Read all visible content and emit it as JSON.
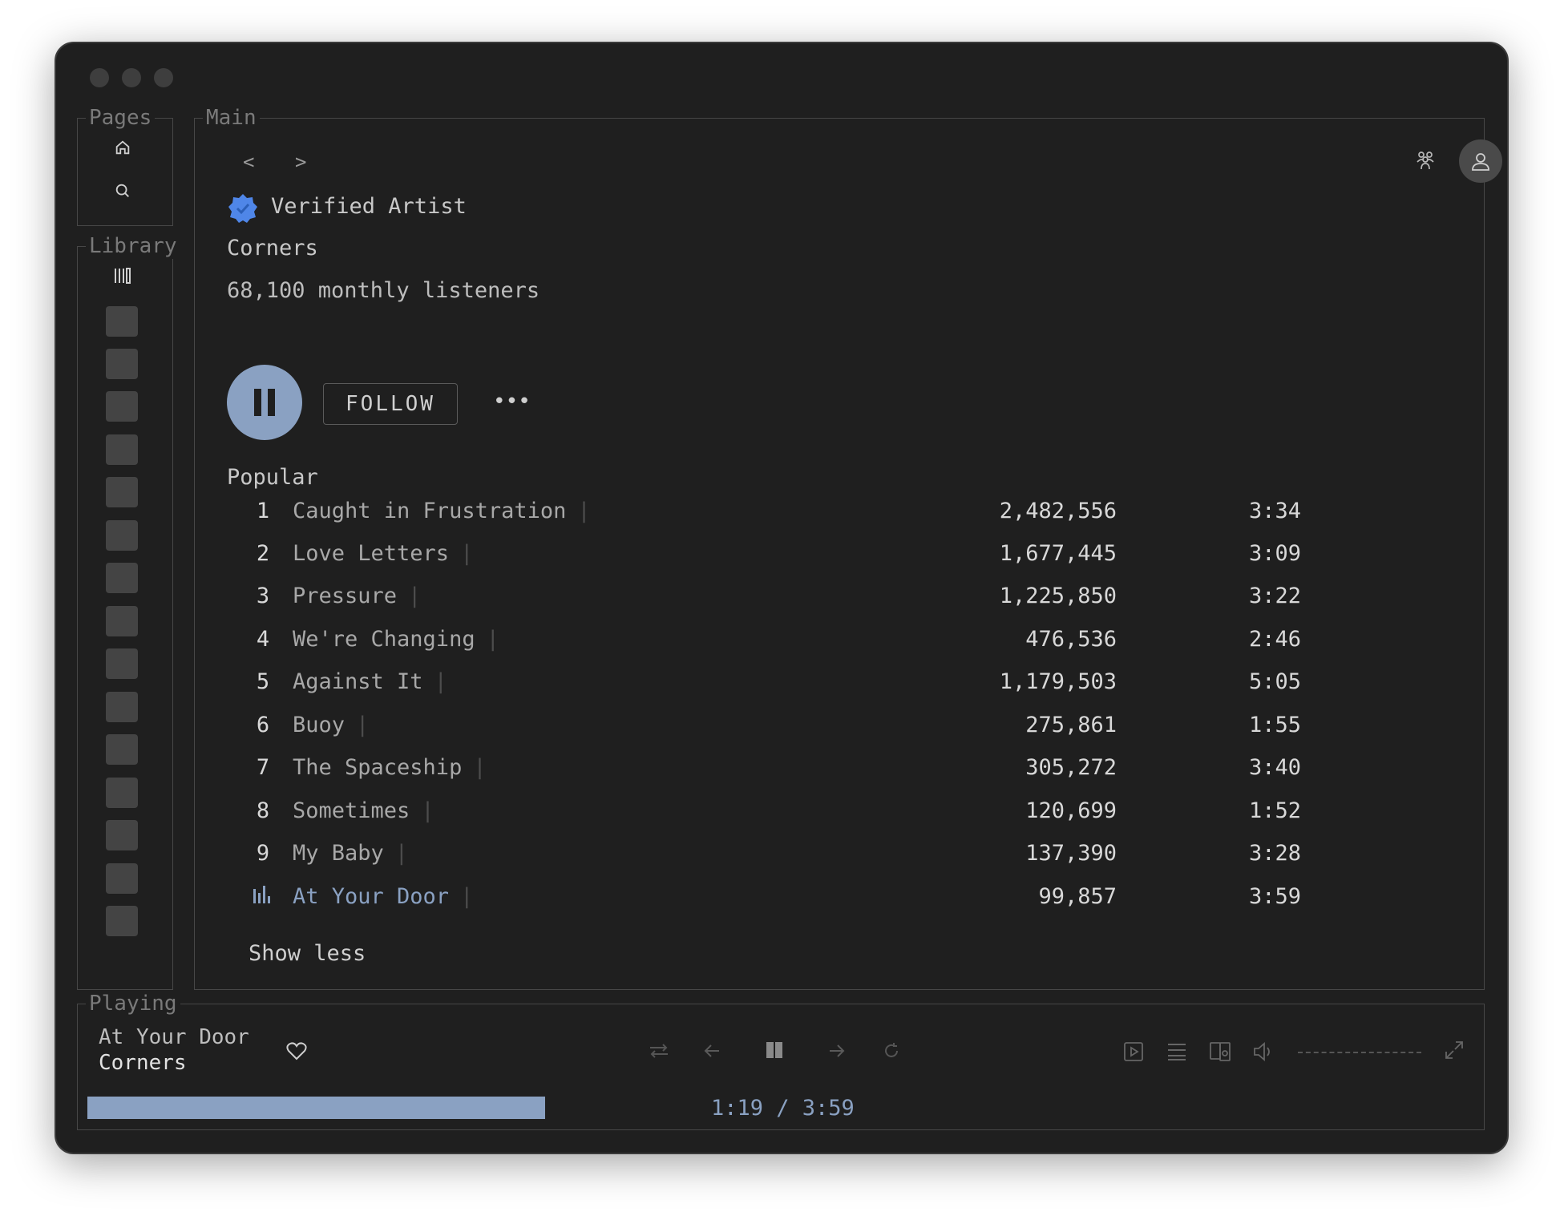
{
  "sections": {
    "pages": "Pages",
    "library": "Library",
    "main": "Main",
    "playing": "Playing"
  },
  "nav": {
    "back": "<",
    "forward": ">"
  },
  "artist": {
    "verified_label": "Verified Artist",
    "name": "Corners",
    "listeners": "68,100 monthly listeners"
  },
  "actions": {
    "follow": "FOLLOW",
    "more": "•••"
  },
  "popular": {
    "heading": "Popular",
    "tracks": [
      {
        "num": "1",
        "title": "Caught in Frustration",
        "plays": "2,482,556",
        "duration": "3:34"
      },
      {
        "num": "2",
        "title": "Love Letters",
        "plays": "1,677,445",
        "duration": "3:09"
      },
      {
        "num": "3",
        "title": "Pressure",
        "plays": "1,225,850",
        "duration": "3:22"
      },
      {
        "num": "4",
        "title": "We're Changing",
        "plays": "476,536",
        "duration": "2:46"
      },
      {
        "num": "5",
        "title": "Against It",
        "plays": "1,179,503",
        "duration": "5:05"
      },
      {
        "num": "6",
        "title": "Buoy",
        "plays": "275,861",
        "duration": "1:55"
      },
      {
        "num": "7",
        "title": "The Spaceship",
        "plays": "305,272",
        "duration": "3:40"
      },
      {
        "num": "8",
        "title": "Sometimes",
        "plays": "120,699",
        "duration": "1:52"
      },
      {
        "num": "9",
        "title": "My Baby",
        "plays": "137,390",
        "duration": "3:28"
      },
      {
        "num": "",
        "title": "At Your Door",
        "plays": "99,857",
        "duration": "3:59"
      }
    ],
    "show_less": "Show less"
  },
  "now_playing": {
    "title": "At Your Door",
    "artist": "Corners",
    "time": "1:19 / 3:59",
    "progress": 0.33
  },
  "colors": {
    "accent": "#8aa1c2",
    "verified": "#4f86e8",
    "window_bg": "#1f1f1f"
  }
}
